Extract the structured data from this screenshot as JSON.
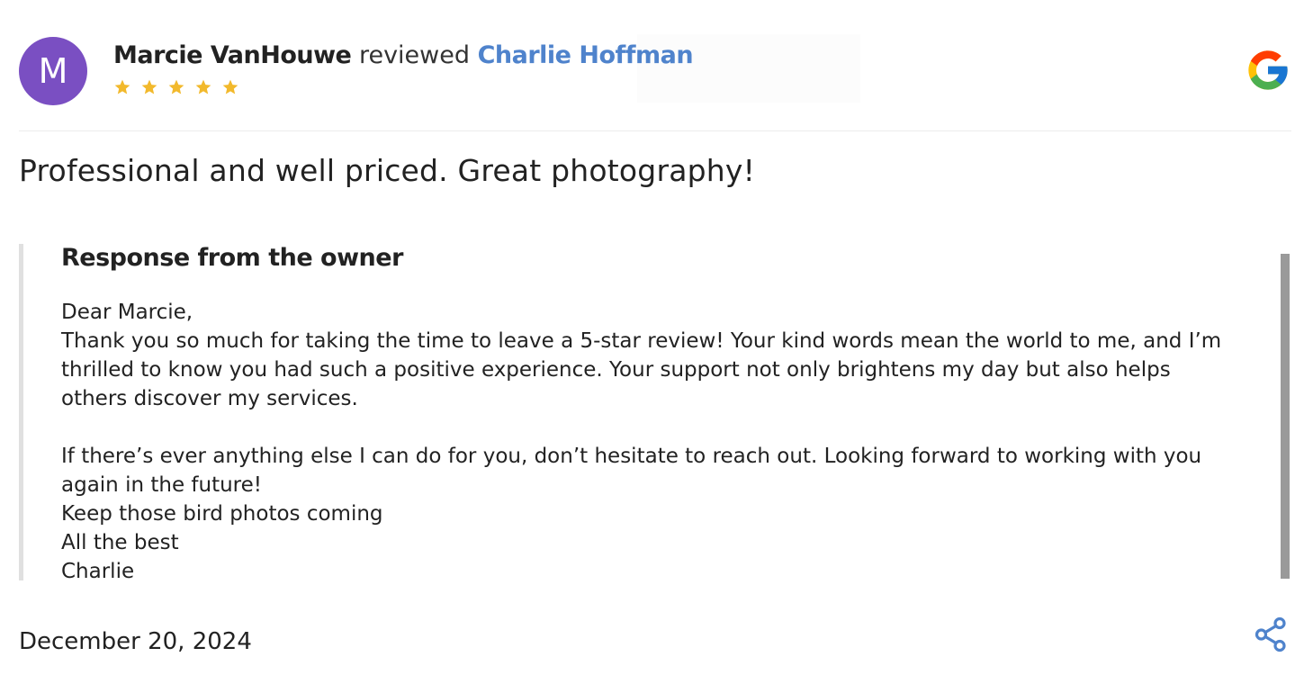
{
  "review": {
    "avatar_letter": "M",
    "avatar_color": "#7a4fc2",
    "reviewer_name": "Marcie VanHouwe",
    "reviewed_word": "reviewed",
    "business_name": "Charlie Hoffman",
    "rating": 5,
    "text": "Professional and well priced. Great photography!",
    "date": "December 20, 2024"
  },
  "response": {
    "title": "Response from the owner",
    "body": "Dear Marcie,\nThank you so much for taking the time to leave a 5-star review! Your kind words mean the world to me, and I’m\nthrilled to know you had such a positive experience. Your support not only brightens my day but also helps\nothers discover my services.\n\nIf there’s ever anything else I can do for you, don’t hesitate to reach out. Looking forward to working with you\nagain in the future!\nKeep those bird photos coming\nAll the best\nCharlie"
  },
  "icons": {
    "source": "google-icon",
    "share": "share-icon",
    "star": "star-icon"
  },
  "colors": {
    "link": "#4f83cc",
    "star": "#f2b92c",
    "share": "#4f83cc"
  }
}
